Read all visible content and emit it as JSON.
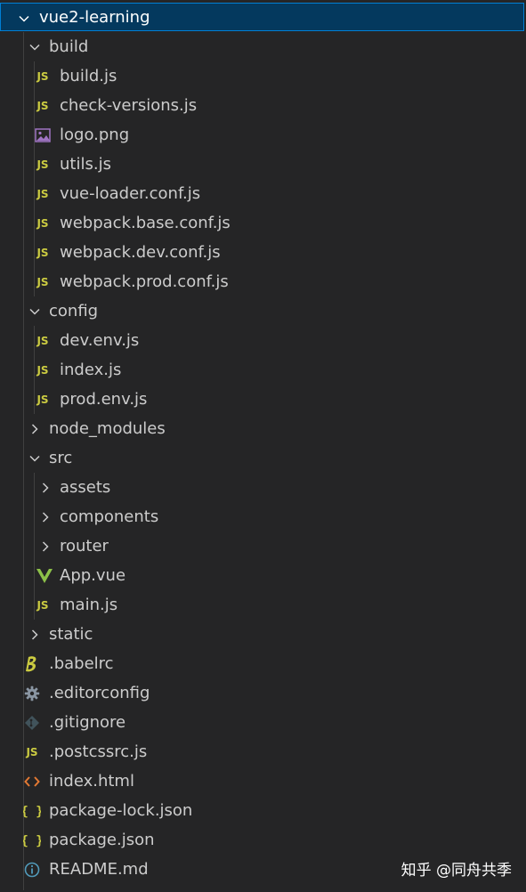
{
  "explorer": {
    "root": {
      "label": "vue2-learning",
      "expanded": true
    },
    "build": {
      "label": "build",
      "files": [
        {
          "label": "build.js",
          "icon": "js-icon"
        },
        {
          "label": "check-versions.js",
          "icon": "js-icon"
        },
        {
          "label": "logo.png",
          "icon": "image-icon"
        },
        {
          "label": "utils.js",
          "icon": "js-icon"
        },
        {
          "label": "vue-loader.conf.js",
          "icon": "js-icon"
        },
        {
          "label": "webpack.base.conf.js",
          "icon": "js-icon"
        },
        {
          "label": "webpack.dev.conf.js",
          "icon": "js-icon"
        },
        {
          "label": "webpack.prod.conf.js",
          "icon": "js-icon"
        }
      ]
    },
    "config": {
      "label": "config",
      "files": [
        {
          "label": "dev.env.js",
          "icon": "js-icon"
        },
        {
          "label": "index.js",
          "icon": "js-icon"
        },
        {
          "label": "prod.env.js",
          "icon": "js-icon"
        }
      ]
    },
    "node_modules": {
      "label": "node_modules"
    },
    "src": {
      "label": "src",
      "folders": [
        {
          "label": "assets"
        },
        {
          "label": "components"
        },
        {
          "label": "router"
        }
      ],
      "files": [
        {
          "label": "App.vue",
          "icon": "vue-icon"
        },
        {
          "label": "main.js",
          "icon": "js-icon"
        }
      ]
    },
    "static": {
      "label": "static"
    },
    "root_files": [
      {
        "label": ".babelrc",
        "icon": "babel-icon"
      },
      {
        "label": ".editorconfig",
        "icon": "gear-icon"
      },
      {
        "label": ".gitignore",
        "icon": "git-icon"
      },
      {
        "label": ".postcssrc.js",
        "icon": "js-icon"
      },
      {
        "label": "index.html",
        "icon": "html-icon"
      },
      {
        "label": "package-lock.json",
        "icon": "json-icon"
      },
      {
        "label": "package.json",
        "icon": "json-icon"
      },
      {
        "label": "README.md",
        "icon": "info-icon"
      }
    ]
  },
  "icons": {
    "js": "JS",
    "json": "{}"
  },
  "watermark": "知乎 @同舟共季",
  "colors": {
    "background": "#252526",
    "selected_row": "#04395e",
    "focus_border": "#007fd4",
    "js": "#cbcb41",
    "vue": "#8dc149",
    "html": "#e37933",
    "image": "#a074c4",
    "info": "#519aba"
  }
}
